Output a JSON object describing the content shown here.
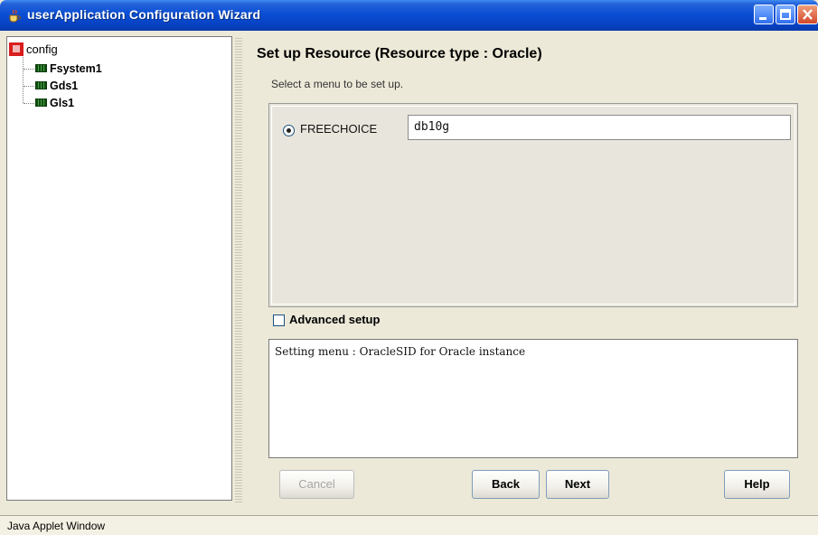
{
  "window": {
    "title": "userApplication Configuration Wizard"
  },
  "tree": {
    "root": "config",
    "children": [
      "Fsystem1",
      "Gds1",
      "Gls1"
    ]
  },
  "panel": {
    "heading": "Set up Resource (Resource type : Oracle)",
    "subtext": "Select a menu to be set up.",
    "choice": {
      "label": "FREECHOICE",
      "value": "db10g",
      "selected": true
    },
    "advanced": {
      "label": "Advanced setup",
      "checked": false
    },
    "info": "Setting menu : OracleSID for Oracle instance"
  },
  "buttons": {
    "cancel": "Cancel",
    "back": "Back",
    "next": "Next",
    "help": "Help"
  },
  "status": "Java Applet Window",
  "colors": {
    "titlebar": "#0a4ed4",
    "root_icon": "#d81e1e",
    "node_icon": "#1a5a1a"
  }
}
